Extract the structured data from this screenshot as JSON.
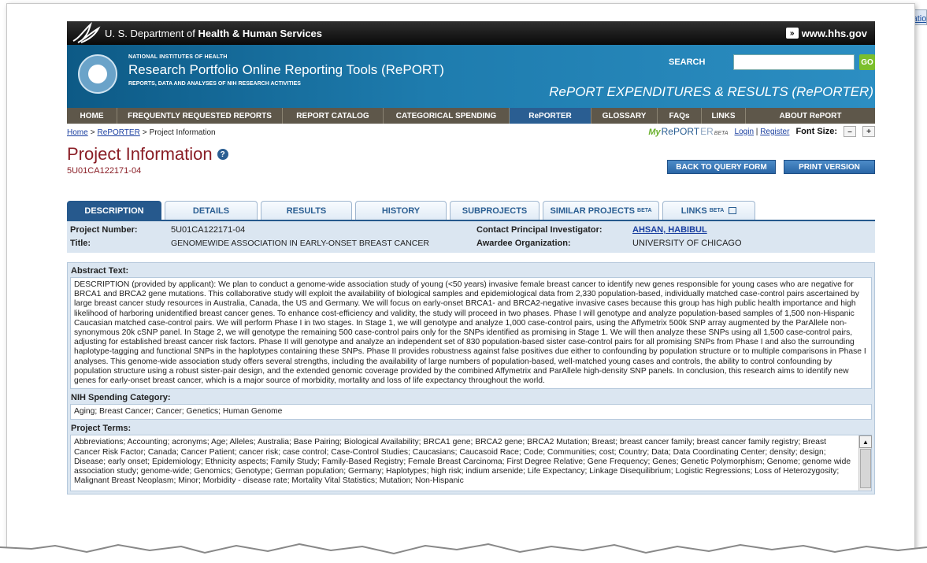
{
  "skip_link": "Skip Navigation",
  "hhs_bar": {
    "dept_prefix": "U. S. Department of ",
    "dept_bold": "Health & Human Services",
    "site": "www.hhs.gov"
  },
  "banner": {
    "nih": "NATIONAL INSTITUTES OF HEALTH",
    "report": "Research Portfolio Online Reporting Tools (RePORT)",
    "subline": "REPORTS, DATA AND ANALYSES OF NIH RESEARCH ACTIVITIES",
    "search_label": "SEARCH",
    "search_value": "",
    "go": "GO",
    "reporter_title": "RePORT EXPENDITURES & RESULTS (RePORTER)"
  },
  "nav": [
    "HOME",
    "FREQUENTLY REQUESTED REPORTS",
    "REPORT CATALOG",
    "CATEGORICAL SPENDING",
    "RePORTER",
    "GLOSSARY",
    "FAQs",
    "LINKS",
    "ABOUT RePORT"
  ],
  "breadcrumb": {
    "home": "Home",
    "sep": ">",
    "reporter": "RePORTER",
    "current": "Project Information"
  },
  "user_tools": {
    "my": "My",
    "rep1": "RePORT",
    "rep2": "ER",
    "beta": "BETA",
    "login": "Login",
    "pipe": "|",
    "register": "Register",
    "font_size": "Font Size:",
    "minus": "–",
    "plus": "+"
  },
  "page": {
    "title": "Project Information",
    "help": "?",
    "project_number": "5U01CA122171-04",
    "back_button": "BACK TO QUERY FORM",
    "print_button": "PRINT VERSION"
  },
  "tabs": [
    {
      "label": "DESCRIPTION",
      "sup": ""
    },
    {
      "label": "DETAILS",
      "sup": ""
    },
    {
      "label": "RESULTS",
      "sup": ""
    },
    {
      "label": "HISTORY",
      "sup": ""
    },
    {
      "label": "SUBPROJECTS",
      "sup": ""
    },
    {
      "label": "SIMILAR PROJECTS",
      "sup": "BETA"
    },
    {
      "label": "LINKS",
      "sup": "BETA"
    }
  ],
  "summary": {
    "project_number_label": "Project Number:",
    "project_number": "5U01CA122171-04",
    "title_label": "Title:",
    "title": "GENOMEWIDE ASSOCIATION IN EARLY-ONSET BREAST CANCER",
    "pi_label": "Contact Principal Investigator:",
    "pi": "AHSAN, HABIBUL",
    "org_label": "Awardee Organization:",
    "org": "UNIVERSITY OF CHICAGO"
  },
  "abstract": {
    "header": "Abstract Text:",
    "text": "DESCRIPTION (provided by applicant): We plan to conduct a genome-wide association study of young (<50 years) invasive female breast cancer to identify new genes responsible for young cases who are negative for BRCA1 and BRCA2 gene mutations. This collaborative study will exploit the availability of biological samples and epidemiological data from 2,330 population-based, individually matched case-control pairs ascertained by large breast cancer study resources in Australia, Canada, the US and Germany. We will focus on early-onset BRCA1- and BRCA2-negative invasive cases because this group has high public health importance and high likelihood of harboring unidentified breast cancer genes. To enhance cost-efficiency and validity, the study will proceed in two phases. Phase I will genotype and analyze population-based samples of 1,500 non-Hispanic Caucasian matched case-control pairs. We will perform Phase I in two stages. In Stage 1, we will genotype and analyze 1,000 case-control pairs, using the Affymetrix 500k SNP array augmented by the ParAllele non-synonymous 20k cSNP panel. In Stage 2, we will genotype the remaining 500 case-control pairs only for the SNPs identified as promising in Stage 1. We will then analyze these SNPs using all 1,500 case-control pairs, adjusting for established breast cancer risk factors. Phase II will genotype and analyze an independent set of 830 population-based sister case-control pairs for all promising SNPs from Phase I and also the surrounding haplotype-tagging and functional SNPs in the haplotypes containing these SNPs. Phase II provides robustness against false positives due either to confounding by population structure or to multiple comparisons in Phase I analyses. This genome-wide association study offers several strengths, including the availability of large numbers of population-based, well-matched young cases and controls, the ability to control confounding by population structure using a robust sister-pair design, and the extended genomic coverage provided by the combined Affymetrix and ParAllele high-density SNP panels. In conclusion, this research aims to identify new genes for early-onset breast cancer, which is a major source of morbidity, mortality and loss of life expectancy throughout the world."
  },
  "spending": {
    "header": "NIH Spending Category:",
    "text": "Aging; Breast Cancer; Cancer; Genetics; Human Genome"
  },
  "terms": {
    "header": "Project Terms:",
    "text": "Abbreviations; Accounting; acronyms; Age; Alleles; Australia; Base Pairing; Biological Availability; BRCA1 gene; BRCA2 gene; BRCA2 Mutation; Breast; breast cancer family; breast cancer family registry; Breast Cancer Risk Factor; Canada; Cancer Patient; cancer risk; case control; Case-Control Studies; Caucasians; Caucasoid Race; Code; Communities; cost; Country; Data; Data Coordinating Center; density; design; Disease; early onset; Epidemiology; Ethnicity aspects; Family Study; Family-Based Registry; Female Breast Carcinoma; First Degree Relative; Gene Frequency; Genes; Genetic Polymorphism; Genome; genome wide association study; genome-wide; Genomics; Genotype; German population; Germany; Haplotypes; high risk; indium arsenide; Life Expectancy; Linkage Disequilibrium; Logistic Regressions; Loss of Heterozygosity; Malignant Breast Neoplasm; Minor; Morbidity - disease rate; Mortality Vital Statistics; Mutation; Non-Hispanic"
  },
  "colors": {
    "nav_bg": "#5e574a",
    "nav_active": "#2a5e92",
    "title_red": "#8a1e26",
    "panel_bg": "#dbe6f1",
    "tab_active": "#26598d"
  }
}
